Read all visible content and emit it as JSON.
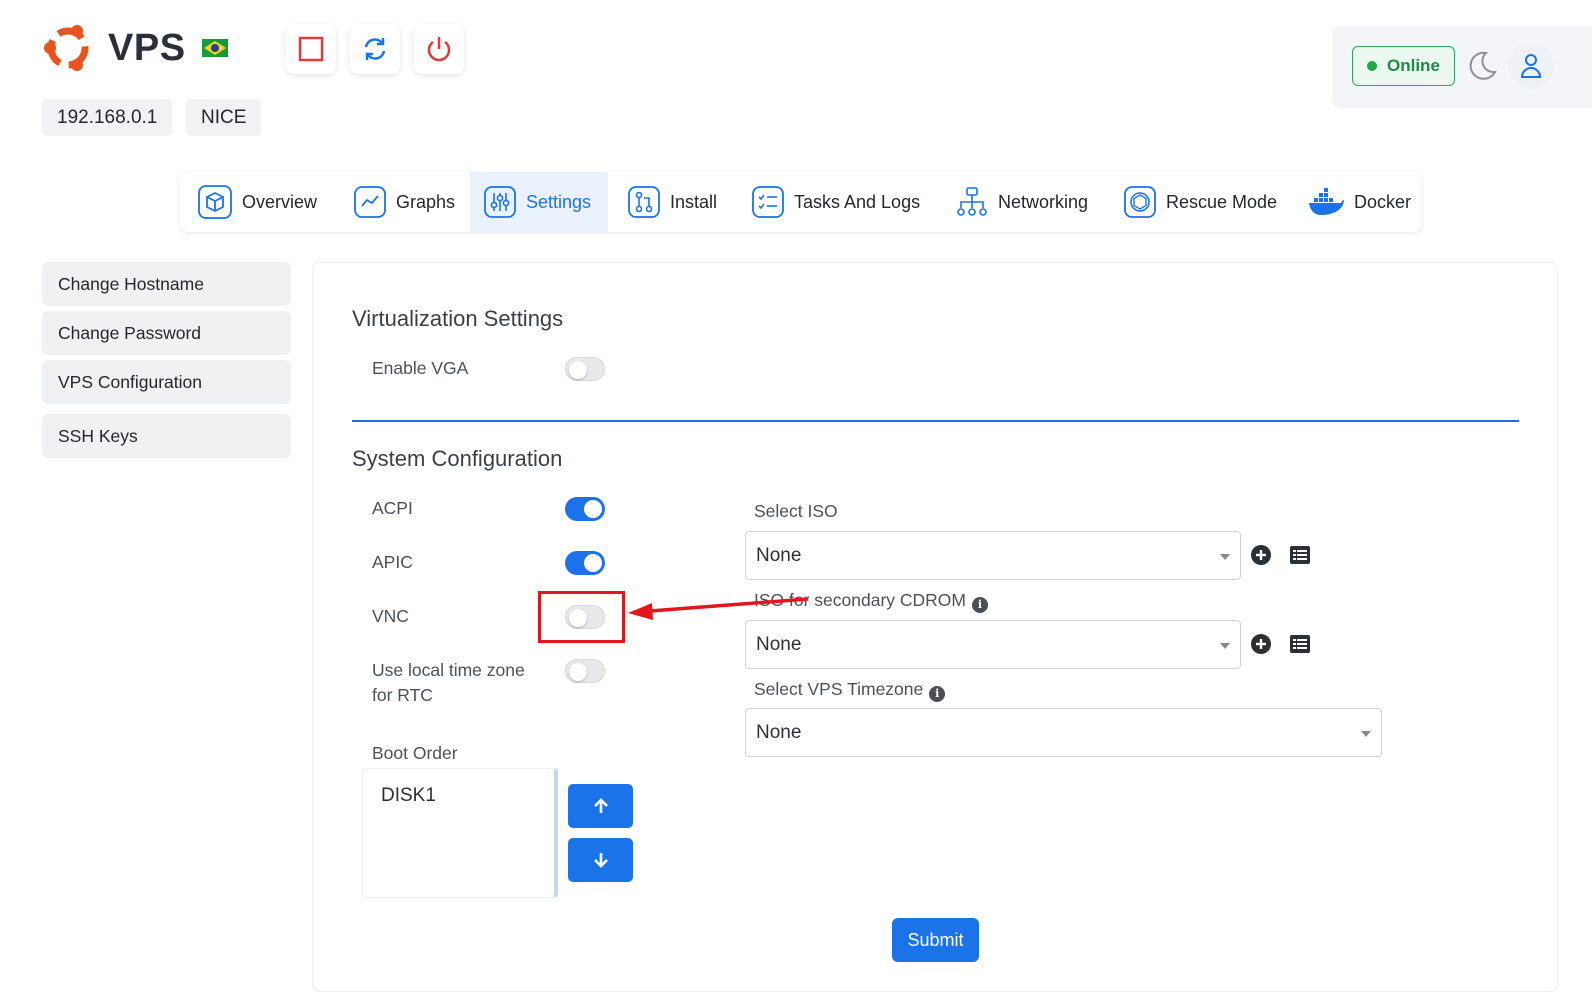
{
  "app": {
    "brand": "VPS",
    "ip": "192.168.0.1",
    "node": "NICE",
    "status": "Online",
    "flag": "brazil-flag"
  },
  "power_controls": [
    {
      "icon": "stop-icon",
      "color": "#e03a3a"
    },
    {
      "icon": "restart-icon",
      "color": "#1a73e8"
    },
    {
      "icon": "power-icon",
      "color": "#e03a3a"
    }
  ],
  "tabs": [
    {
      "label": "Overview",
      "icon": "cube-icon"
    },
    {
      "label": "Graphs",
      "icon": "chart-line-icon"
    },
    {
      "label": "Settings",
      "icon": "sliders-icon",
      "active": true
    },
    {
      "label": "Install",
      "icon": "git-branch-icon"
    },
    {
      "label": "Tasks And Logs",
      "icon": "checklist-icon"
    },
    {
      "label": "Networking",
      "icon": "network-icon"
    },
    {
      "label": "Rescue Mode",
      "icon": "rescue-icon"
    },
    {
      "label": "Docker",
      "icon": "docker-icon"
    }
  ],
  "sidebar": {
    "items": [
      {
        "label": "Change Hostname"
      },
      {
        "label": "Change Password"
      },
      {
        "label": "VPS Configuration"
      },
      {
        "label": "SSH Keys"
      }
    ]
  },
  "virtualization": {
    "title": "Virtualization Settings",
    "enable_vga": {
      "label": "Enable VGA",
      "on": false
    }
  },
  "system": {
    "title": "System Configuration",
    "acpi": {
      "label": "ACPI",
      "on": true
    },
    "apic": {
      "label": "APIC",
      "on": true
    },
    "vnc": {
      "label": "VNC",
      "on": false
    },
    "rtc": {
      "label_line1": "Use local time zone",
      "label_line2": "for RTC",
      "on": false
    },
    "boot_order": {
      "label": "Boot Order",
      "items": [
        "DISK1"
      ]
    },
    "select_iso": {
      "label": "Select ISO",
      "value": "None"
    },
    "secondary_cdrom": {
      "label": "ISO for secondary CDROM",
      "value": "None"
    },
    "timezone": {
      "label": "Select VPS Timezone",
      "value": "None"
    },
    "submit_label": "Submit"
  },
  "colors": {
    "accent": "#1a73e8",
    "online": "#1f8b47",
    "annotation": "#e3161e"
  }
}
